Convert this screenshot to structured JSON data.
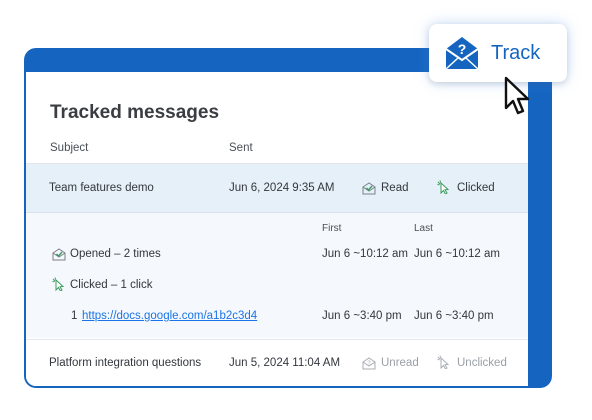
{
  "header": {
    "title": "Tracked messages",
    "columns": {
      "subject": "Subject",
      "sent": "Sent"
    }
  },
  "rows": [
    {
      "subject": "Team features demo",
      "sent": "Jun 6, 2024  9:35 AM",
      "open_status": "Read",
      "click_status": "Clicked"
    },
    {
      "subject": "Platform integration questions",
      "sent": "Jun 5, 2024  11:04 AM",
      "open_status": "Unread",
      "click_status": "Unclicked"
    }
  ],
  "details": {
    "first_label": "First",
    "last_label": "Last",
    "opened": {
      "label": "Opened – 2 times",
      "first": "Jun 6 ~10:12 am",
      "last": "Jun 6 ~10:12 am"
    },
    "clicked": {
      "label": "Clicked – 1 click"
    },
    "link": {
      "index": "1",
      "url": "https://docs.google.com/a1b2c3d4",
      "first": "Jun 6 ~3:40 pm",
      "last": "Jun 6 ~3:40 pm"
    }
  },
  "track_button": {
    "label": "Track",
    "icon": "envelope-question-icon"
  },
  "colors": {
    "brand": "#1565c0",
    "link": "#1a73e8",
    "selected_row": "#e6f0f9",
    "expanded_bg": "#f5f9fd",
    "success": "#3a9b5c"
  }
}
